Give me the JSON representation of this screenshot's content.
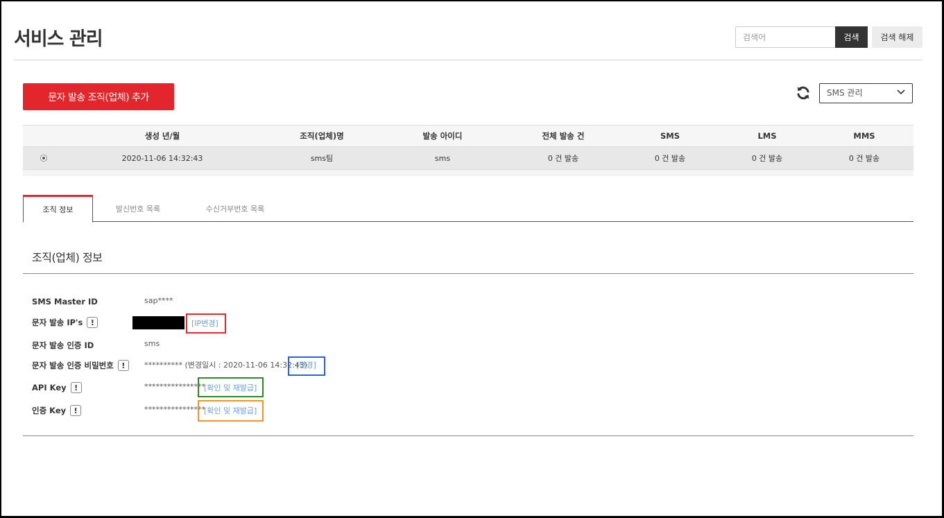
{
  "header": {
    "title": "서비스 관리",
    "search_placeholder": "검색어",
    "search_label": "검색",
    "reset_label": "검색 해제"
  },
  "toolbar": {
    "add_label": "문자 발송 조직(업체) 추가",
    "refresh_icon": "refresh-icon",
    "select_value": "SMS 관리"
  },
  "grid": {
    "columns": [
      "생성 년/월",
      "조직(업체)명",
      "발송 아이디",
      "전체 발송 건",
      "SMS",
      "LMS",
      "MMS"
    ],
    "rows": [
      {
        "selected": true,
        "created": "2020-11-06 14:32:43",
        "org_name": "sms팀",
        "sender_id": "sms",
        "total": "0 건 발송",
        "sms": "0 건 발송",
        "lms": "0 건 발송",
        "mms": "0 건 발송"
      }
    ]
  },
  "tabs": [
    {
      "label": "조직 정보",
      "active": true
    },
    {
      "label": "발신번호 목록",
      "active": false
    },
    {
      "label": "수신거부번호 목록",
      "active": false
    }
  ],
  "info": {
    "section_title": "조직(업체) 정보",
    "master_id_label": "SMS Master ID",
    "master_id_value": "sap****",
    "ip_label": "문자 발송 IP's",
    "ip_change_link": "[IP변경]",
    "auth_id_label": "문자 발송 인증 ID",
    "auth_id_value": "sms",
    "password_label": "문자 발송 인증 비밀번호",
    "password_value": "********** (변경일시 : 2020-11-06 14:32:43)",
    "password_change_link": "[변경]",
    "api_key_label": "API Key",
    "api_key_value": "****************",
    "api_key_link": "[확인 및 재발급]",
    "auth_key_label": "인증 Key",
    "auth_key_value": "****************",
    "auth_key_link": "[확인 및 재발급]",
    "warn_symbol": "!"
  },
  "colors": {
    "accent": "#e2262b",
    "link": "#6a9fd8",
    "highlight_red": "#e2262b",
    "highlight_blue": "#2266dd",
    "highlight_green": "#2a8a2a",
    "highlight_orange": "#f0951e"
  }
}
